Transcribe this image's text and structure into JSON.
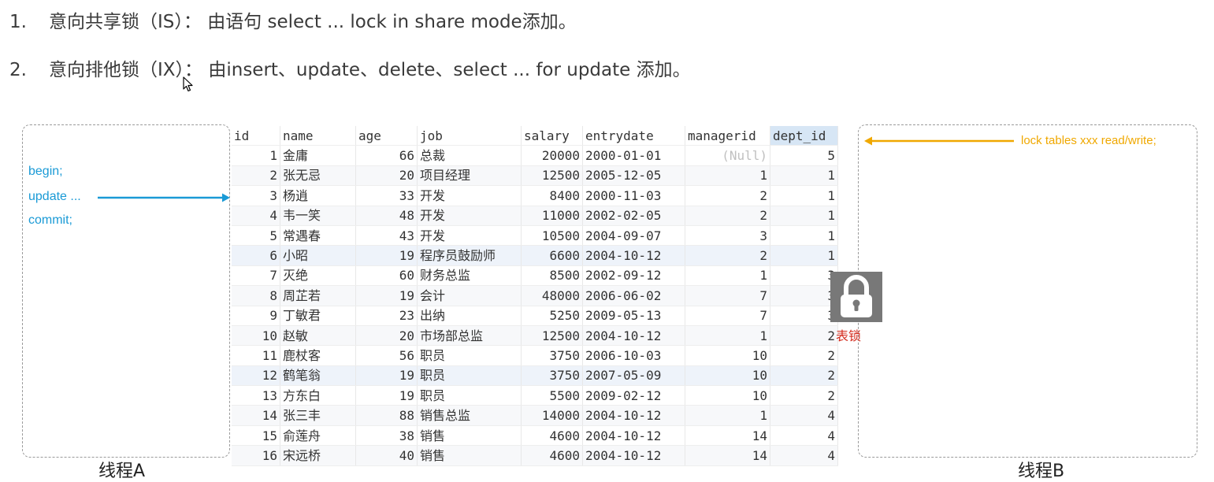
{
  "bullets": [
    {
      "num": "1.",
      "text": "意向共享锁（IS）： 由语句 select ... lock  in share mode添加。"
    },
    {
      "num": "2.",
      "text": "意向排他锁（IX）： 由insert、update、delete、select ... for update 添加。"
    }
  ],
  "thread_a": {
    "label": "线程A",
    "code": [
      "begin;",
      "update ...",
      "commit;"
    ]
  },
  "thread_b": {
    "label": "线程B",
    "lock_statement": "lock tables xxx read/write;"
  },
  "lock_icon": {
    "caption": "表锁",
    "icon": "padlock-icon"
  },
  "colors": {
    "thread_a_text": "#1a9ad6",
    "thread_b_text": "#f0a800",
    "lock_caption": "#d42c1e",
    "highlight_header": "#d7e6f5"
  },
  "table": {
    "columns": [
      "id",
      "name",
      "age",
      "job",
      "salary",
      "entrydate",
      "managerid",
      "dept_id"
    ],
    "highlighted_column": "dept_id",
    "rows": [
      [
        "1",
        "金庸",
        "66",
        "总裁",
        "20000",
        "2000-01-01",
        "(Null)",
        "5"
      ],
      [
        "2",
        "张无忌",
        "20",
        "项目经理",
        "12500",
        "2005-12-05",
        "1",
        "1"
      ],
      [
        "3",
        "杨逍",
        "33",
        "开发",
        "8400",
        "2000-11-03",
        "2",
        "1"
      ],
      [
        "4",
        "韦一笑",
        "48",
        "开发",
        "11000",
        "2002-02-05",
        "2",
        "1"
      ],
      [
        "5",
        "常遇春",
        "43",
        "开发",
        "10500",
        "2004-09-07",
        "3",
        "1"
      ],
      [
        "6",
        "小昭",
        "19",
        "程序员鼓励师",
        "6600",
        "2004-10-12",
        "2",
        "1"
      ],
      [
        "7",
        "灭绝",
        "60",
        "财务总监",
        "8500",
        "2002-09-12",
        "1",
        "3"
      ],
      [
        "8",
        "周芷若",
        "19",
        "会计",
        "48000",
        "2006-06-02",
        "7",
        "3"
      ],
      [
        "9",
        "丁敏君",
        "23",
        "出纳",
        "5250",
        "2009-05-13",
        "7",
        "3"
      ],
      [
        "10",
        "赵敏",
        "20",
        "市场部总监",
        "12500",
        "2004-10-12",
        "1",
        "2"
      ],
      [
        "11",
        "鹿杖客",
        "56",
        "职员",
        "3750",
        "2006-10-03",
        "10",
        "2"
      ],
      [
        "12",
        "鹤笔翁",
        "19",
        "职员",
        "3750",
        "2007-05-09",
        "10",
        "2"
      ],
      [
        "13",
        "方东白",
        "19",
        "职员",
        "5500",
        "2009-02-12",
        "10",
        "2"
      ],
      [
        "14",
        "张三丰",
        "88",
        "销售总监",
        "14000",
        "2004-10-12",
        "1",
        "4"
      ],
      [
        "15",
        "俞莲舟",
        "38",
        "销售",
        "4600",
        "2004-10-12",
        "14",
        "4"
      ],
      [
        "16",
        "宋远桥",
        "40",
        "销售",
        "4600",
        "2004-10-12",
        "14",
        "4"
      ]
    ]
  }
}
